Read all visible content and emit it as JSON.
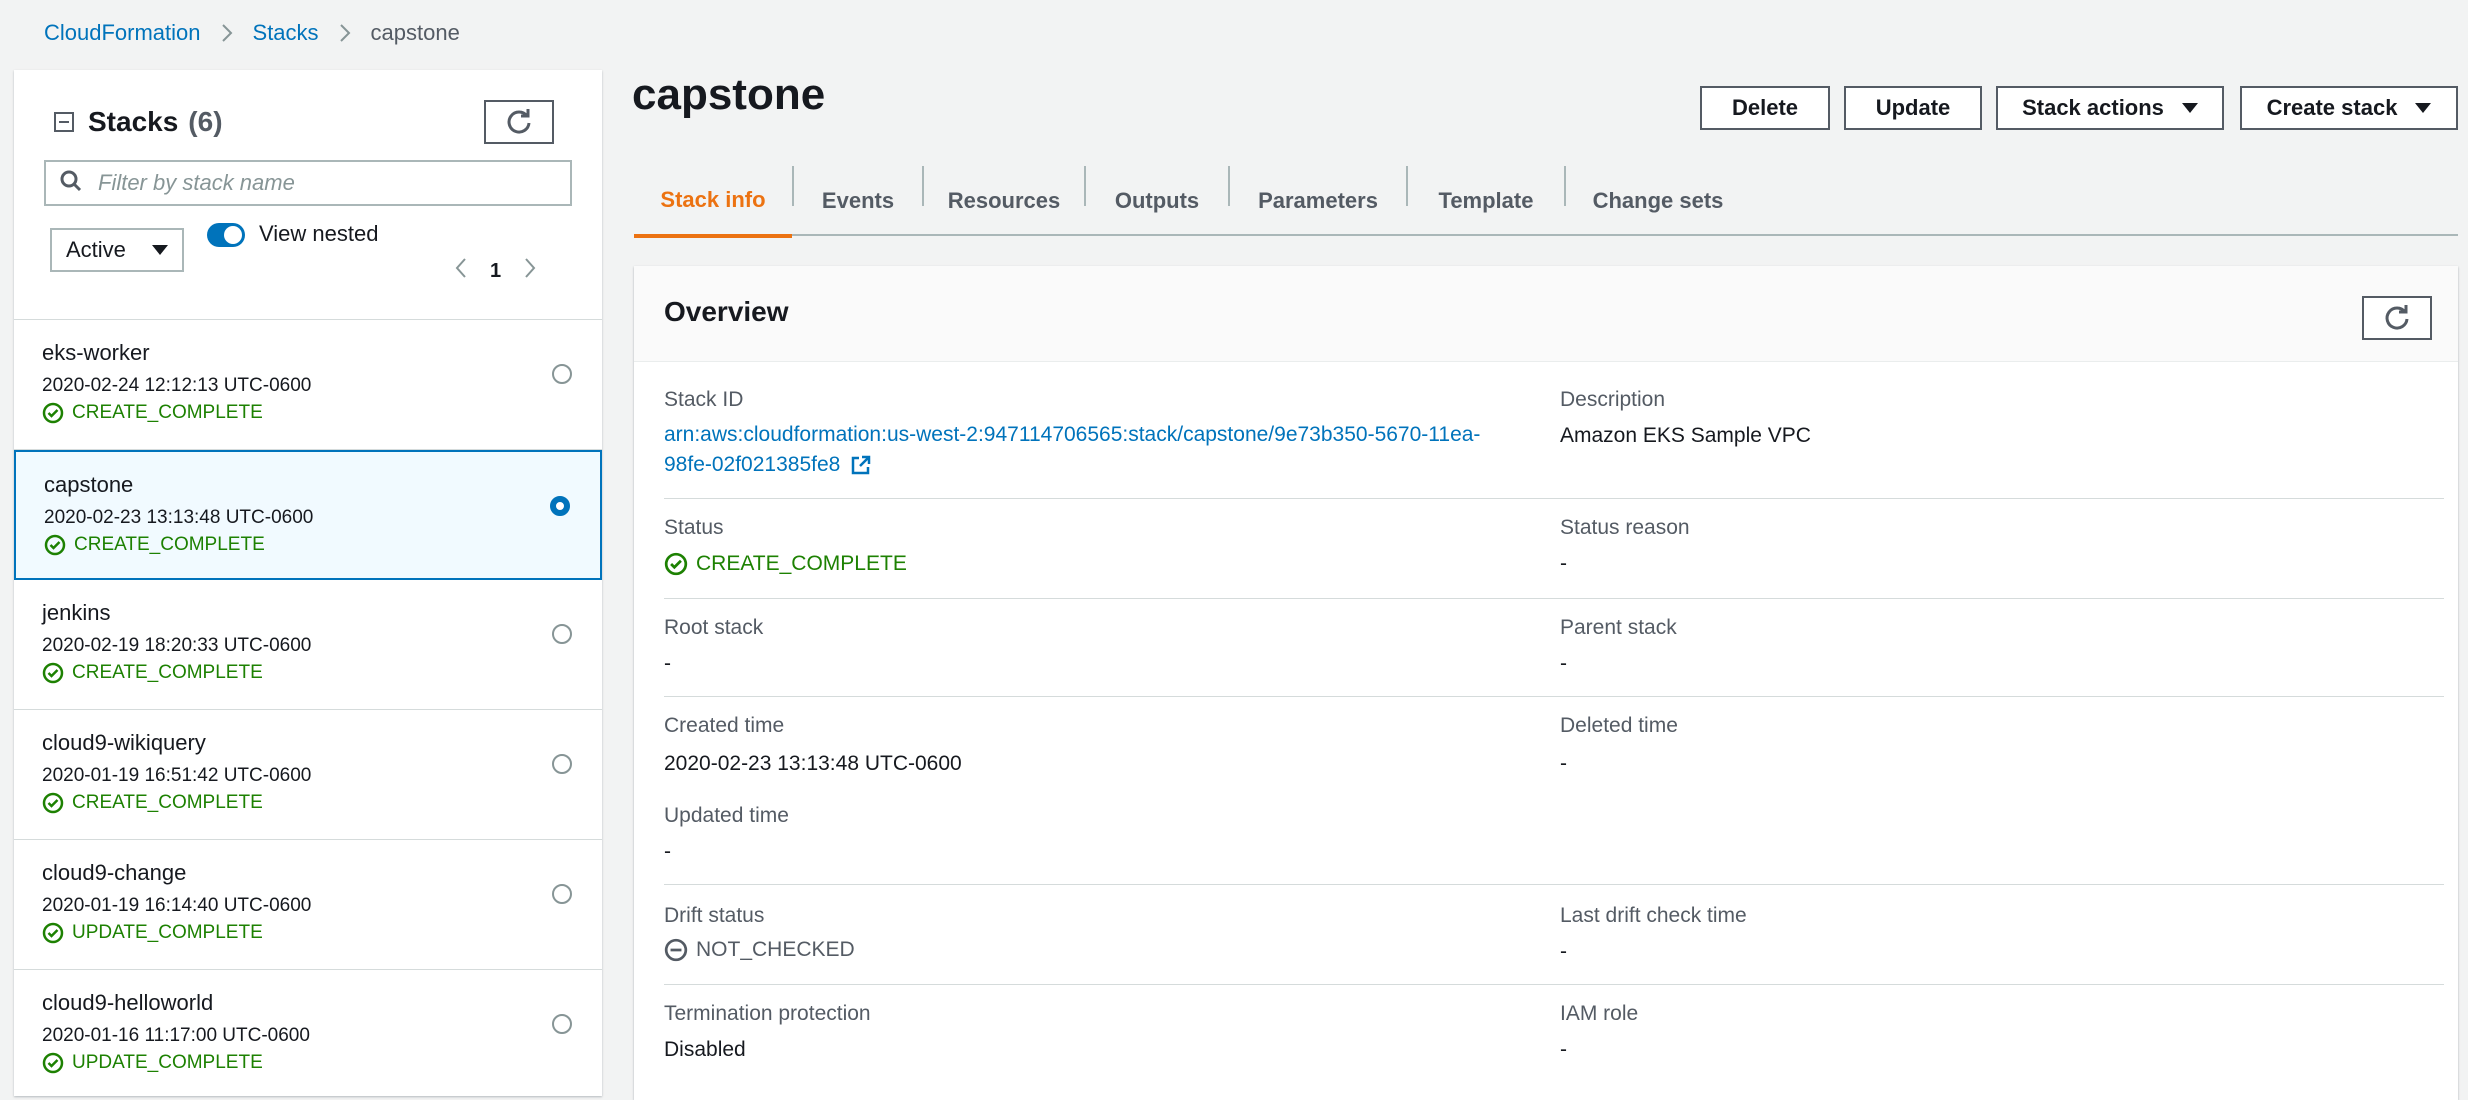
{
  "breadcrumb": {
    "items": [
      "CloudFormation",
      "Stacks",
      "capstone"
    ]
  },
  "left_panel": {
    "title": "Stacks",
    "count": "(6)",
    "search_placeholder": "Filter by stack name",
    "status_filter": "Active",
    "view_nested_label": "View nested",
    "view_nested_on": true,
    "page": "1",
    "stacks": [
      {
        "name": "eks-worker",
        "date": "2020-02-24 12:12:13 UTC-0600",
        "status": "CREATE_COMPLETE",
        "selected": false
      },
      {
        "name": "capstone",
        "date": "2020-02-23 13:13:48 UTC-0600",
        "status": "CREATE_COMPLETE",
        "selected": true
      },
      {
        "name": "jenkins",
        "date": "2020-02-19 18:20:33 UTC-0600",
        "status": "CREATE_COMPLETE",
        "selected": false
      },
      {
        "name": "cloud9-wikiquery",
        "date": "2020-01-19 16:51:42 UTC-0600",
        "status": "CREATE_COMPLETE",
        "selected": false
      },
      {
        "name": "cloud9-change",
        "date": "2020-01-19 16:14:40 UTC-0600",
        "status": "UPDATE_COMPLETE",
        "selected": false
      },
      {
        "name": "cloud9-helloworld",
        "date": "2020-01-16 11:17:00 UTC-0600",
        "status": "UPDATE_COMPLETE",
        "selected": false
      }
    ]
  },
  "main": {
    "title": "capstone",
    "buttons": {
      "delete": "Delete",
      "update": "Update",
      "stack_actions": "Stack actions",
      "create_stack": "Create stack"
    },
    "tabs": [
      "Stack info",
      "Events",
      "Resources",
      "Outputs",
      "Parameters",
      "Template",
      "Change sets"
    ],
    "active_tab": "Stack info"
  },
  "overview": {
    "title": "Overview",
    "stack_id_label": "Stack ID",
    "stack_id_line1": "arn:aws:cloudformation:us-west-2:947114706565:stack/capstone/9e73b350-5670-11ea-",
    "stack_id_line2": "98fe-02f021385fe8",
    "description_label": "Description",
    "description_value": "Amazon EKS Sample VPC",
    "status_label": "Status",
    "status_value": "CREATE_COMPLETE",
    "status_reason_label": "Status reason",
    "status_reason_value": "-",
    "root_stack_label": "Root stack",
    "root_stack_value": "-",
    "parent_stack_label": "Parent stack",
    "parent_stack_value": "-",
    "created_time_label": "Created time",
    "created_time_value": "2020-02-23 13:13:48 UTC-0600",
    "deleted_time_label": "Deleted time",
    "deleted_time_value": "-",
    "updated_time_label": "Updated time",
    "updated_time_value": "-",
    "drift_status_label": "Drift status",
    "drift_status_value": "NOT_CHECKED",
    "last_drift_label": "Last drift check time",
    "last_drift_value": "-",
    "termination_label": "Termination protection",
    "termination_value": "Disabled",
    "iam_role_label": "IAM role",
    "iam_role_value": "-"
  },
  "colors": {
    "link": "#0073bb",
    "success": "#1d8102",
    "active_tab": "#ec7211",
    "page_bg": "#f2f3f3"
  }
}
